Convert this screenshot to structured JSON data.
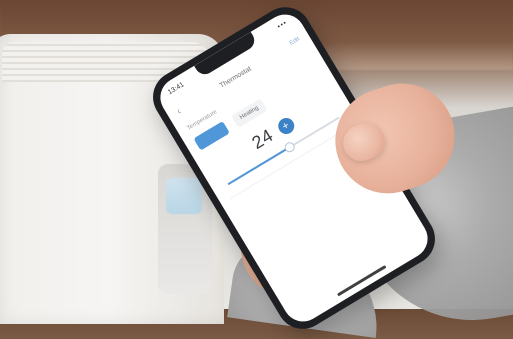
{
  "phone_ui": {
    "status": {
      "time": "13:41",
      "right": "•••"
    },
    "appbar": {
      "back": "‹",
      "title": "Thermostat",
      "action": "Edit"
    },
    "section_label": "Temperature",
    "tabs": [
      {
        "label": "",
        "active": true
      },
      {
        "label": "Heating",
        "active": false
      }
    ],
    "setpoint": {
      "value": "24",
      "plus": "+"
    },
    "slider": {
      "fraction": 0.55
    },
    "hint": ""
  },
  "colors": {
    "accent": "#4f97d8",
    "accent_dark": "#3b82c6",
    "heater_white": "#f2f1ee",
    "wood_wall": "#6a4633",
    "sweater_grey": "#a9a9a9"
  }
}
